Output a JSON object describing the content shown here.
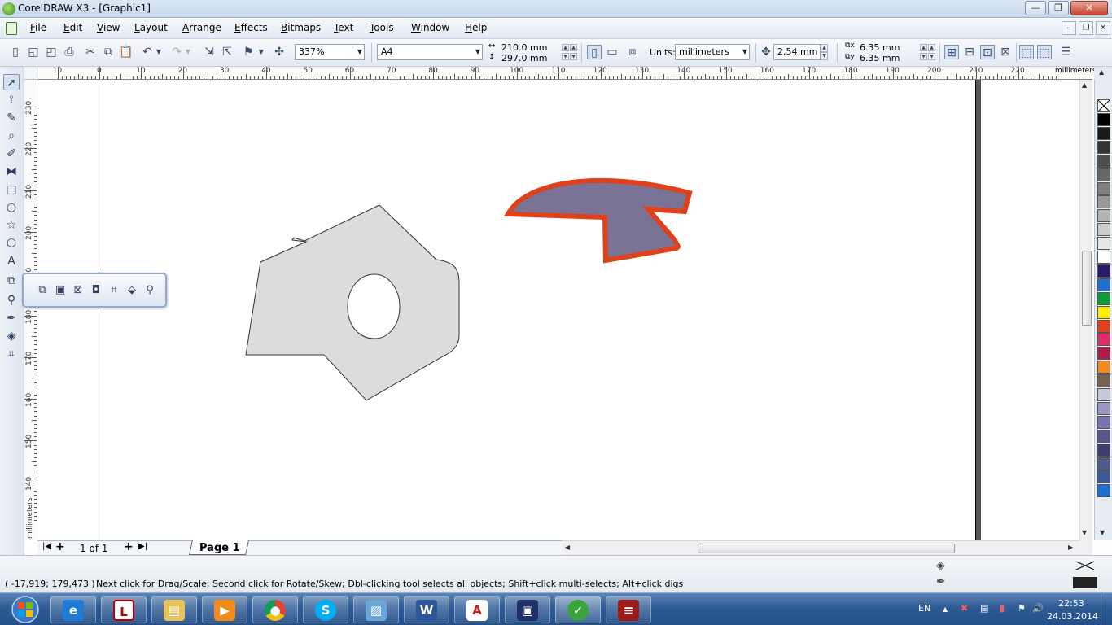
{
  "window": {
    "title": "CorelDRAW X3 - [Graphic1]",
    "controls": {
      "minimize": "—",
      "maximize": "❐",
      "close": "✕"
    }
  },
  "menu": {
    "items": [
      {
        "label": "File"
      },
      {
        "label": "Edit"
      },
      {
        "label": "View"
      },
      {
        "label": "Layout"
      },
      {
        "label": "Arrange"
      },
      {
        "label": "Effects"
      },
      {
        "label": "Bitmaps"
      },
      {
        "label": "Text"
      },
      {
        "label": "Tools"
      },
      {
        "label": "Window"
      },
      {
        "label": "Help"
      }
    ],
    "mdi": {
      "minimize": "–",
      "restore": "❐",
      "close": "✕"
    }
  },
  "toolbar": {
    "zoom": "337%",
    "page_size": "A4",
    "page_width": "210.0 mm",
    "page_height": "297.0 mm",
    "units_label": "Units:",
    "units_value": "millimeters",
    "nudge": "2,54 mm",
    "dup_x": "6.35 mm",
    "dup_y": "6.35 mm"
  },
  "rulers": {
    "unit_label": "millimeters",
    "h_labels": [
      "10",
      "0",
      "10",
      "20",
      "30",
      "40",
      "50",
      "60",
      "70",
      "80",
      "90",
      "100",
      "110",
      "120",
      "130",
      "140",
      "150",
      "160",
      "170",
      "180",
      "190",
      "200",
      "210",
      "220"
    ],
    "v_labels": [
      "230",
      "220",
      "210",
      "200",
      "190",
      "180",
      "170",
      "160",
      "150",
      "140"
    ]
  },
  "page_nav": {
    "counter": "1 of 1",
    "tab_label": "Page 1"
  },
  "palette": {
    "colors": [
      "#000000",
      "#1a1a1a",
      "#333333",
      "#4d4d4d",
      "#666666",
      "#808080",
      "#999999",
      "#b3b3b3",
      "#cccccc",
      "#e6e6e6",
      "#ffffff",
      "#2b1a6b",
      "#1e6fd0",
      "#0f9b3a",
      "#ffee00",
      "#e0401a",
      "#e02a6a",
      "#b01c4a",
      "#f08a1a",
      "#7a6250",
      "#c8c8d8",
      "#9c94c4",
      "#7a72b0",
      "#5a5490",
      "#3e3e6e",
      "#4f5a88",
      "#3a5a9a",
      "#1c6fd0"
    ]
  },
  "status": {
    "coords": "( -17,919; 179,473 )",
    "hint": "Next click for Drag/Scale; Second click for Rotate/Skew; Dbl-clicking tool selects all objects; Shift+click multi-selects; Alt+click digs"
  },
  "taskbar": {
    "language": "EN",
    "time": "22:53",
    "date": "24.03.2014"
  },
  "colors": {
    "shape_gray_fill": "#dcdcdc",
    "shape_purple_fill": "#7a7396",
    "shape_outline": "#e0401a"
  }
}
